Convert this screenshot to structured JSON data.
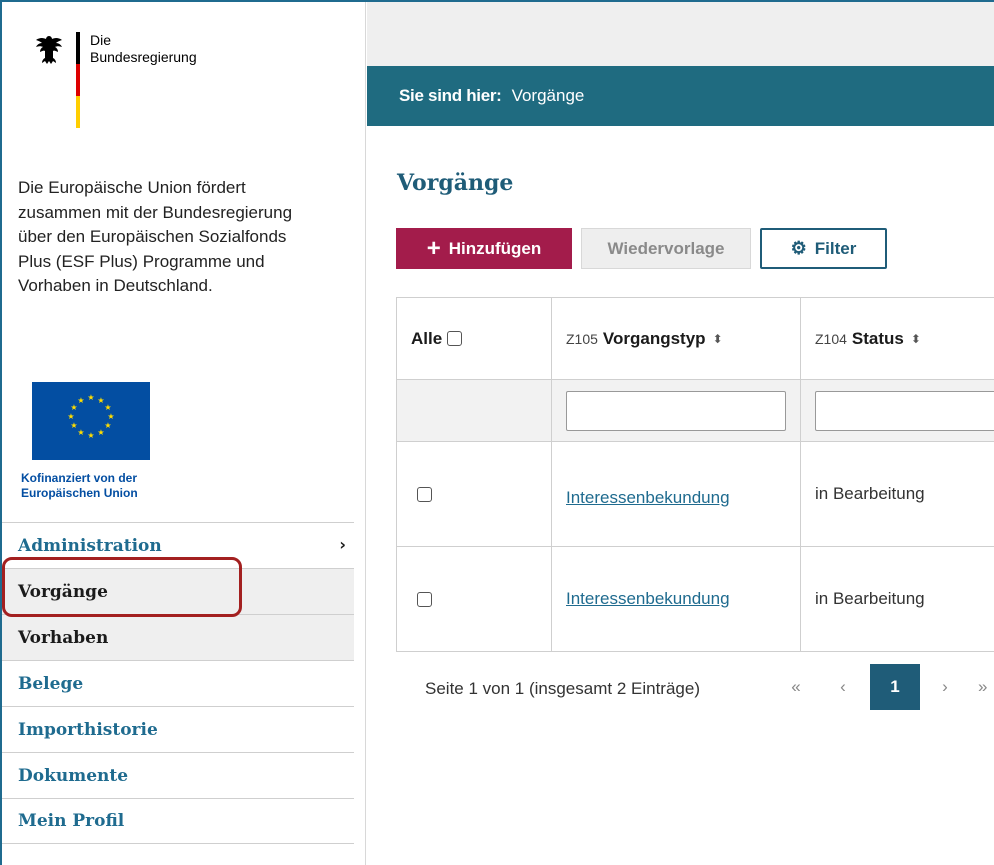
{
  "branding": {
    "line1": "Die",
    "line2": "Bundesregierung"
  },
  "sidebar": {
    "intro_text": "Die Europäische Union fördert zusammen mit der Bundesregierung über den Europäischen Sozialfonds Plus (ESF Plus) Programme und Vorhaben in Deutschland.",
    "eu_caption_line1": "Kofinanziert von der",
    "eu_caption_line2": "Europäischen Union",
    "nav": [
      {
        "label": "Administration",
        "chevron": "›"
      },
      {
        "label": "Vorgänge"
      },
      {
        "label": "Vorhaben"
      },
      {
        "label": "Belege"
      },
      {
        "label": "Importhistorie"
      },
      {
        "label": "Dokumente"
      },
      {
        "label": "Mein Profil"
      }
    ]
  },
  "breadcrumb": {
    "label": "Sie sind hier:",
    "current": "Vorgänge"
  },
  "main": {
    "title": "Vorgänge",
    "buttons": {
      "add": "Hinzufügen",
      "resubmit": "Wiedervorlage",
      "filter": "Filter"
    },
    "table": {
      "headers": {
        "select_all": "Alle",
        "type_code": "Z105",
        "type_label": "Vorgangstyp",
        "status_code": "Z104",
        "status_label": "Status"
      },
      "rows": [
        {
          "type": "Interessenbekundung",
          "status": "in Bearbeitung"
        },
        {
          "type": "Interessenbekundung",
          "status": "in Bearbeitung"
        }
      ]
    },
    "pagination": {
      "summary": "Seite 1 von 1 (insgesamt 2 Einträge)",
      "first": "«",
      "prev": "‹",
      "current": "1",
      "next": "›",
      "last": "»"
    }
  },
  "colors": {
    "primary": "#1f6b80",
    "add_button": "#a31c4b",
    "highlight": "#a32020",
    "eu_blue": "#034ea2"
  },
  "icons": [
    "federal-eagle-icon",
    "eu-flag-icon",
    "plus-icon",
    "gear-icon",
    "sort-icon",
    "chevron-right-icon"
  ]
}
